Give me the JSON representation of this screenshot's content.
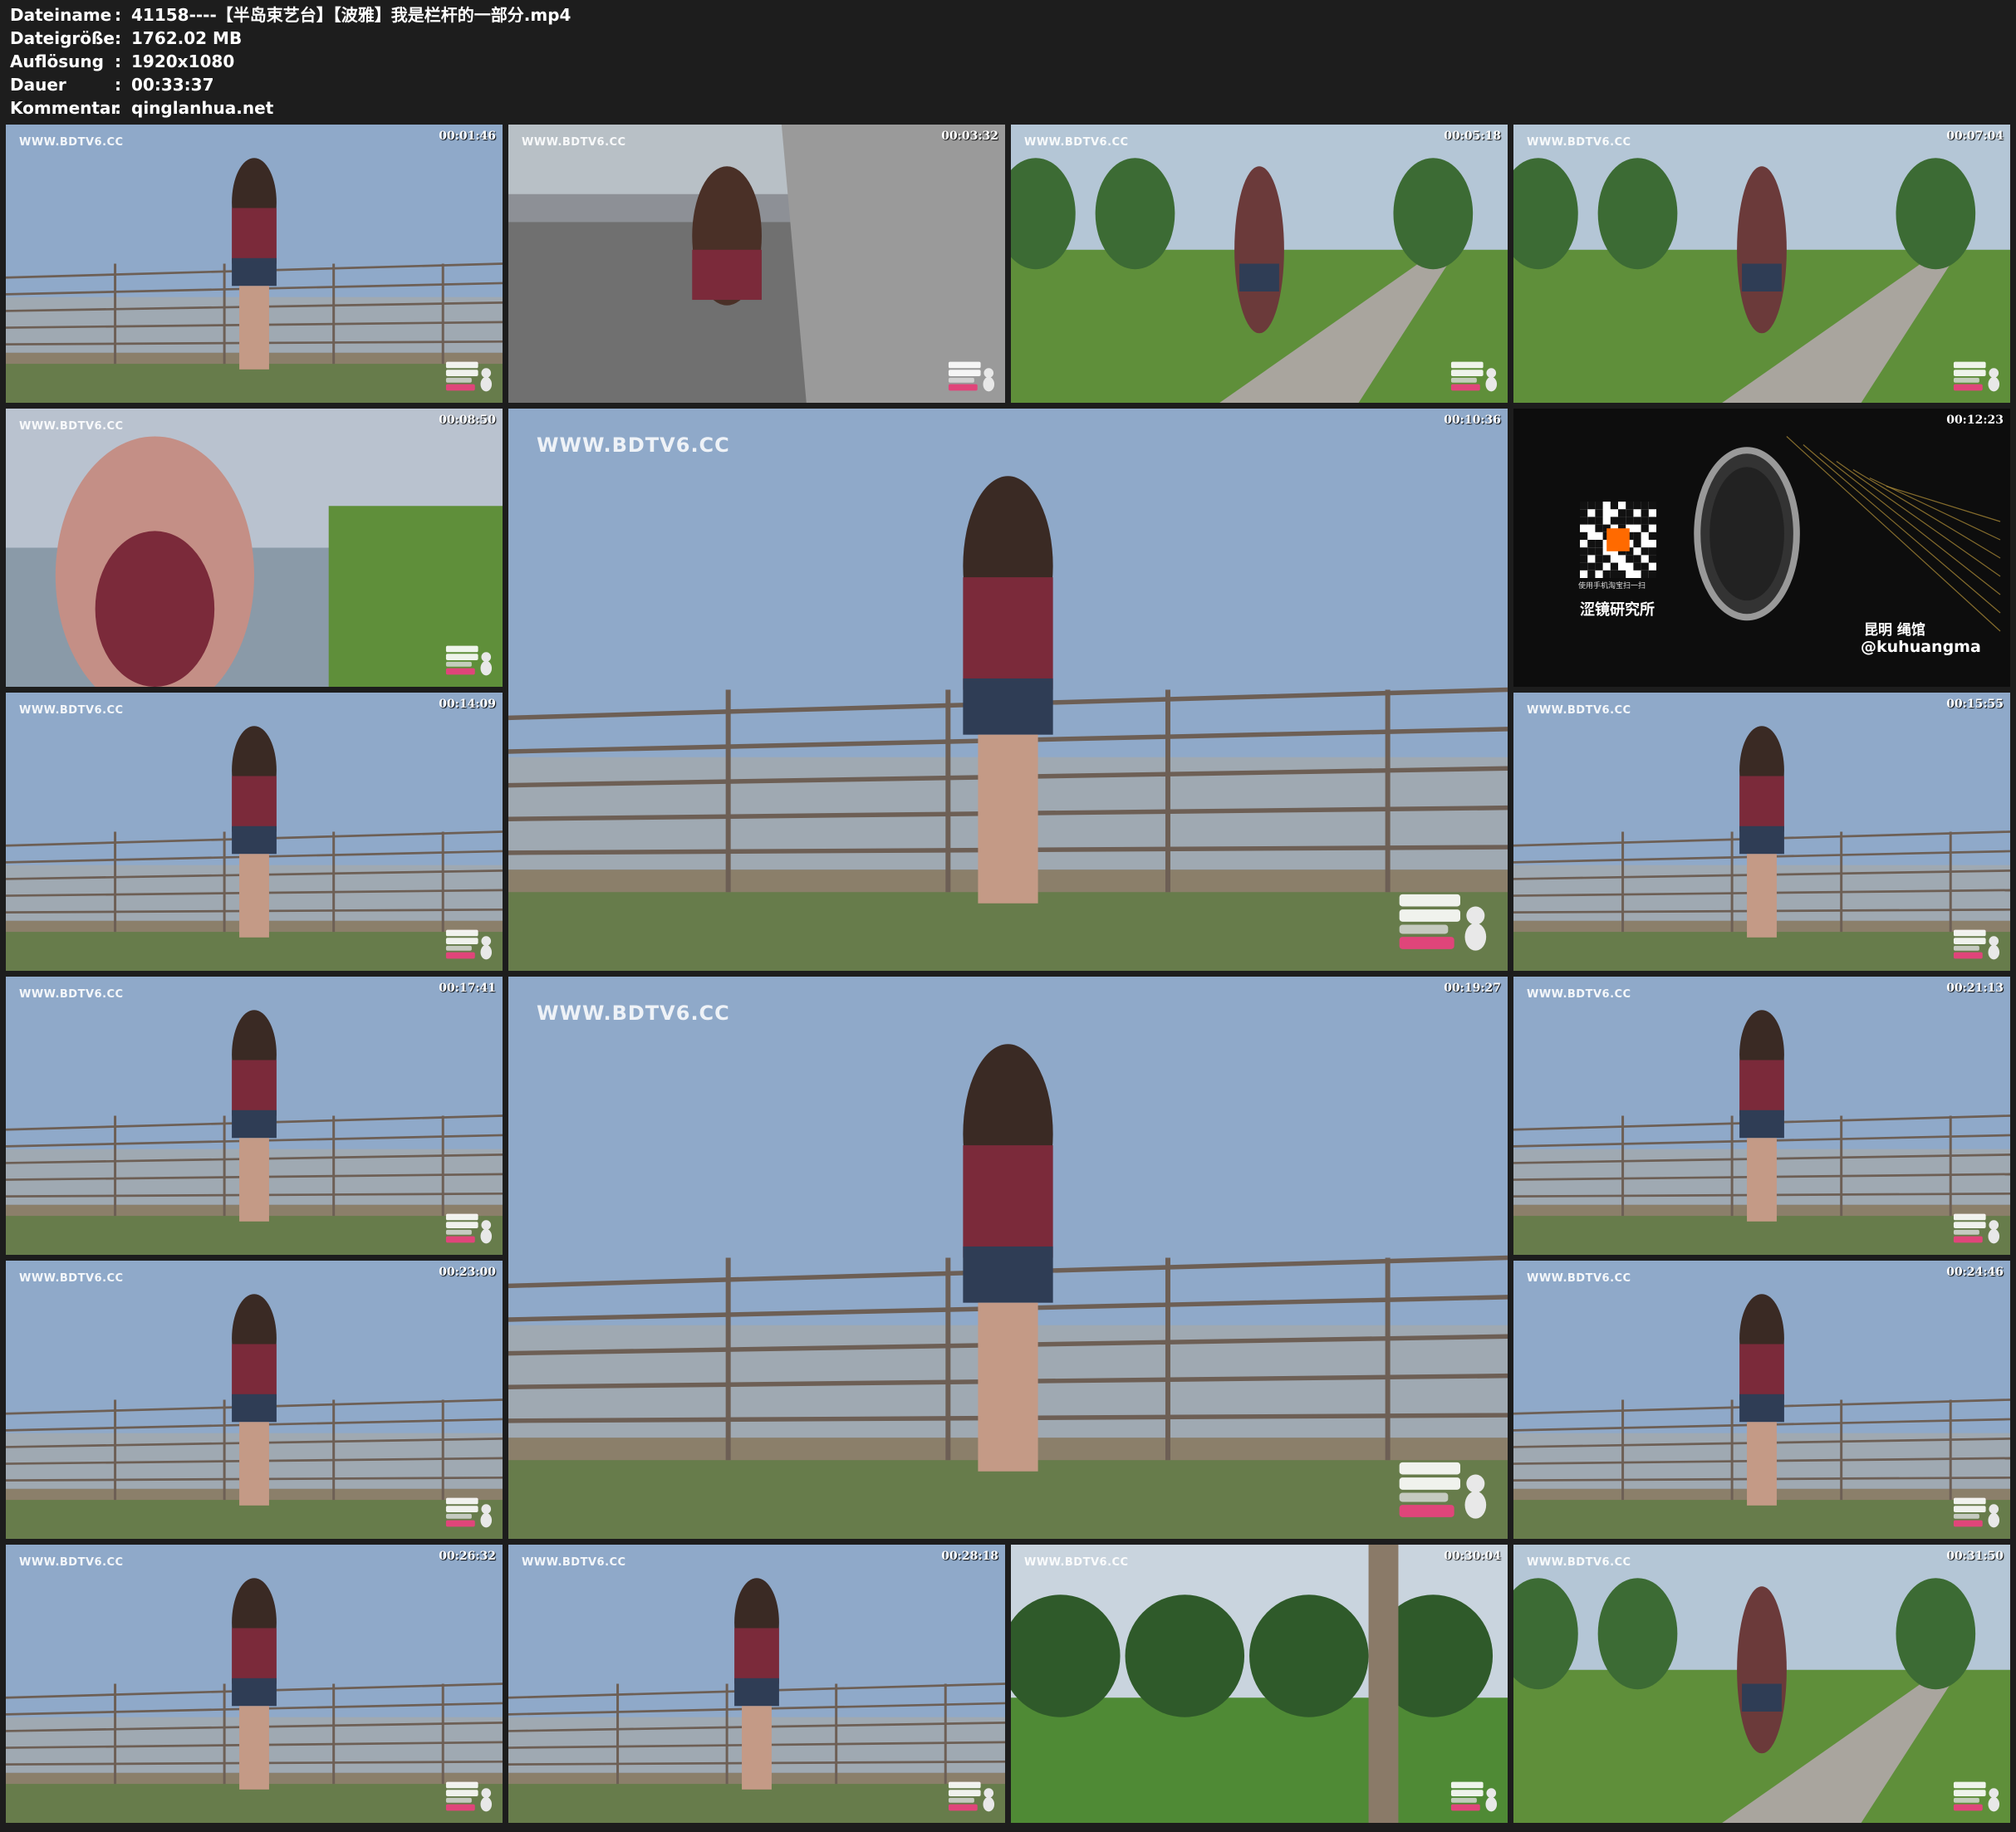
{
  "header": {
    "rows": [
      {
        "key": "Dateiname",
        "value": "41158----【半岛束艺台】【波雅】我是栏杆的一部分.mp4"
      },
      {
        "key": "Dateigröße",
        "value": "1762.02 MB"
      },
      {
        "key": "Auflösung",
        "value": "1920x1080"
      },
      {
        "key": "Dauer",
        "value": "00:33:37"
      },
      {
        "key": "Kommentar",
        "value": "qinglanhua.net"
      }
    ],
    "separator": ":"
  },
  "watermark": "WWW.BDTV6.CC",
  "thumbnails": [
    {
      "timestamp": "00:01:46",
      "scene": "railing-sky"
    },
    {
      "timestamp": "00:03:32",
      "scene": "wall-sitting"
    },
    {
      "timestamp": "00:05:18",
      "scene": "path-green"
    },
    {
      "timestamp": "00:07:04",
      "scene": "path-green"
    },
    {
      "timestamp": "00:08:50",
      "scene": "closeup"
    },
    {
      "timestamp": "00:10:36",
      "scene": "railing-big"
    },
    {
      "timestamp": "00:12:23",
      "scene": "ad"
    },
    {
      "timestamp": "00:14:09",
      "scene": "railing-sky"
    },
    {
      "timestamp": "00:15:55",
      "scene": "railing-sky"
    },
    {
      "timestamp": "00:17:41",
      "scene": "railing-sky"
    },
    {
      "timestamp": "00:19:27",
      "scene": "railing-big"
    },
    {
      "timestamp": "00:21:13",
      "scene": "railing-sky"
    },
    {
      "timestamp": "00:23:00",
      "scene": "railing-sky"
    },
    {
      "timestamp": "00:24:46",
      "scene": "railing-sky"
    },
    {
      "timestamp": "00:26:32",
      "scene": "railing-sky"
    },
    {
      "timestamp": "00:28:18",
      "scene": "railing-sky"
    },
    {
      "timestamp": "00:30:04",
      "scene": "trees"
    },
    {
      "timestamp": "00:31:50",
      "scene": "path-green"
    }
  ],
  "ad": {
    "brand": "涩镜研究所",
    "qr_hint": "使用手机淘宝扫一扫",
    "cn_label": "昆明 绳馆",
    "handle": "@kuhuangma"
  },
  "colors": {
    "background": "#1d1d1d",
    "text": "#ffffff",
    "sky": "#8fa9c9",
    "grass": "#5f8f3a",
    "rail": "#6d5f55",
    "logo_pink": "#e0457a"
  }
}
